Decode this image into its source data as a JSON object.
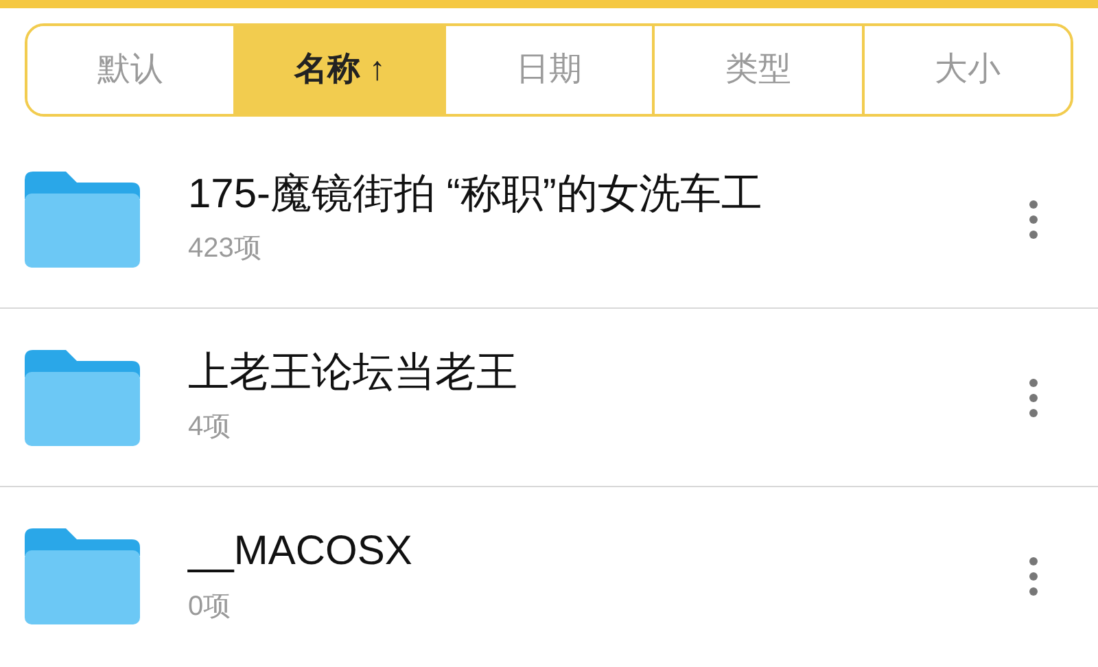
{
  "sort_tabs": [
    {
      "label": "默认",
      "selected": false
    },
    {
      "label": "名称 ↑",
      "selected": true
    },
    {
      "label": "日期",
      "selected": false
    },
    {
      "label": "类型",
      "selected": false
    },
    {
      "label": "大小",
      "selected": false
    }
  ],
  "files": [
    {
      "name": "175-魔镜街拍 “称职”的女洗车工",
      "count": "423项"
    },
    {
      "name": "上老王论坛当老王",
      "count": "4项"
    },
    {
      "name": "__MACOSX",
      "count": "0项"
    }
  ]
}
